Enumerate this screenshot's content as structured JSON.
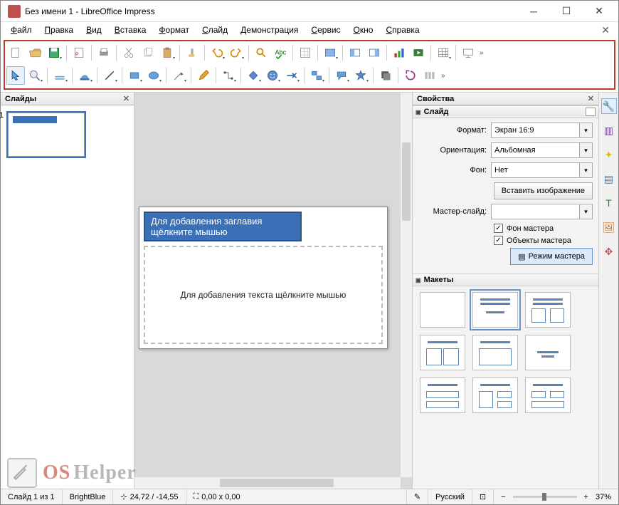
{
  "title": "Без имени 1 - LibreOffice Impress",
  "menu": [
    "Файл",
    "Правка",
    "Вид",
    "Вставка",
    "Формат",
    "Слайд",
    "Демонстрация",
    "Сервис",
    "Окно",
    "Справка"
  ],
  "panels": {
    "slides": "Слайды",
    "props": "Свойства",
    "slide_sect": "Слайд",
    "layouts_sect": "Макеты"
  },
  "slide_thumb_num": "1",
  "placeholders": {
    "title": "Для добавления заглавия щёлкните мышью",
    "content": "Для добавления текста щёлкните мышью"
  },
  "props": {
    "format_label": "Формат:",
    "format_value": "Экран 16:9",
    "orientation_label": "Ориентация:",
    "orientation_value": "Альбомная",
    "background_label": "Фон:",
    "background_value": "Нет",
    "insert_image_btn": "Вставить изображение",
    "master_label": "Мастер-слайд:",
    "master_value": "",
    "chk_master_bg": "Фон мастера",
    "chk_master_obj": "Объекты мастера",
    "master_mode_btn": "Режим мастера"
  },
  "status": {
    "slide_count": "Слайд 1 из 1",
    "theme": "BrightBlue",
    "pos": "24,72 / -14,55",
    "size": "0,00 x 0,00",
    "lang": "Русский",
    "zoom": "37%"
  },
  "icons": {
    "toolbar1": [
      "new",
      "open",
      "save",
      "",
      "export-pdf",
      "",
      "print",
      "",
      "cut",
      "copy",
      "paste",
      "",
      "clone-format",
      "",
      "undo",
      "redo",
      "",
      "find-replace",
      "spellcheck",
      "",
      "grid",
      "",
      "table-toolbar",
      "",
      "image-left",
      "image-right",
      "",
      "chart",
      "media",
      "",
      "table",
      "",
      "start-show"
    ],
    "toolbar2": [
      "pointer",
      "zoom",
      "",
      "text-box",
      "",
      "fill",
      "",
      "line",
      "",
      "rectangle",
      "ellipse",
      "",
      "line-arrow",
      "",
      "pencil",
      "",
      "connector",
      "",
      "basic-shapes",
      "smiley",
      "arrows",
      "",
      "align-obj",
      "",
      "callout",
      "star",
      "",
      "shadow3d",
      "",
      "rotate",
      "distribute"
    ]
  },
  "sidebar_tabs": [
    "properties",
    "slide-transition",
    "animation",
    "master",
    "styles",
    "gallery",
    "navigator"
  ],
  "watermark": {
    "os": "OS",
    "helper": "Helper"
  }
}
